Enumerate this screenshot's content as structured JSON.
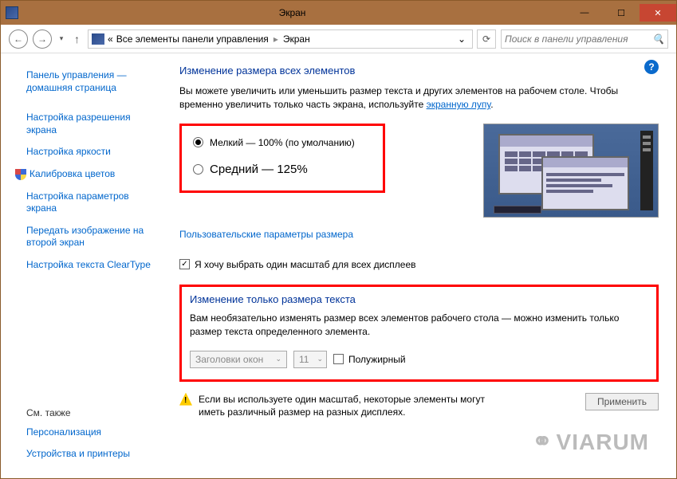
{
  "window": {
    "title": "Экран"
  },
  "breadcrumb": {
    "level1": "Все элементы панели управления",
    "level2": "Экран",
    "dbl_arrow": "«"
  },
  "search": {
    "placeholder": "Поиск в панели управления"
  },
  "sidebar": {
    "items": [
      "Панель управления — домашняя страница",
      "Настройка разрешения экрана",
      "Настройка яркости",
      "Калибровка цветов",
      "Настройка параметров экрана",
      "Передать изображение на второй экран",
      "Настройка текста ClearType"
    ],
    "see_also": "См. также",
    "bottom": [
      "Персонализация",
      "Устройства и принтеры"
    ]
  },
  "main": {
    "heading": "Изменение размера всех элементов",
    "desc_pre": "Вы можете увеличить или уменьшить размер текста и других элементов на рабочем столе. Чтобы временно увеличить только часть экрана, используйте ",
    "desc_link": "экранную лупу",
    "desc_post": ".",
    "radio_small": "Мелкий — 100% (по умолчанию)",
    "radio_medium": "Средний — 125%",
    "custom_link": "Пользовательские параметры размера",
    "checkbox": "Я хочу выбрать один масштаб для всех дисплеев"
  },
  "textsize": {
    "heading": "Изменение только размера текста",
    "desc": "Вам необязательно изменять размер всех элементов рабочего стола — можно изменить только размер текста определенного элемента.",
    "select_item": "Заголовки окон",
    "select_size": "11",
    "bold": "Полужирный"
  },
  "warning": {
    "text": "Если вы используете один масштаб, некоторые элементы могут иметь различный размер на разных дисплеях.",
    "apply": "Применить"
  },
  "watermark": "VIARUM"
}
